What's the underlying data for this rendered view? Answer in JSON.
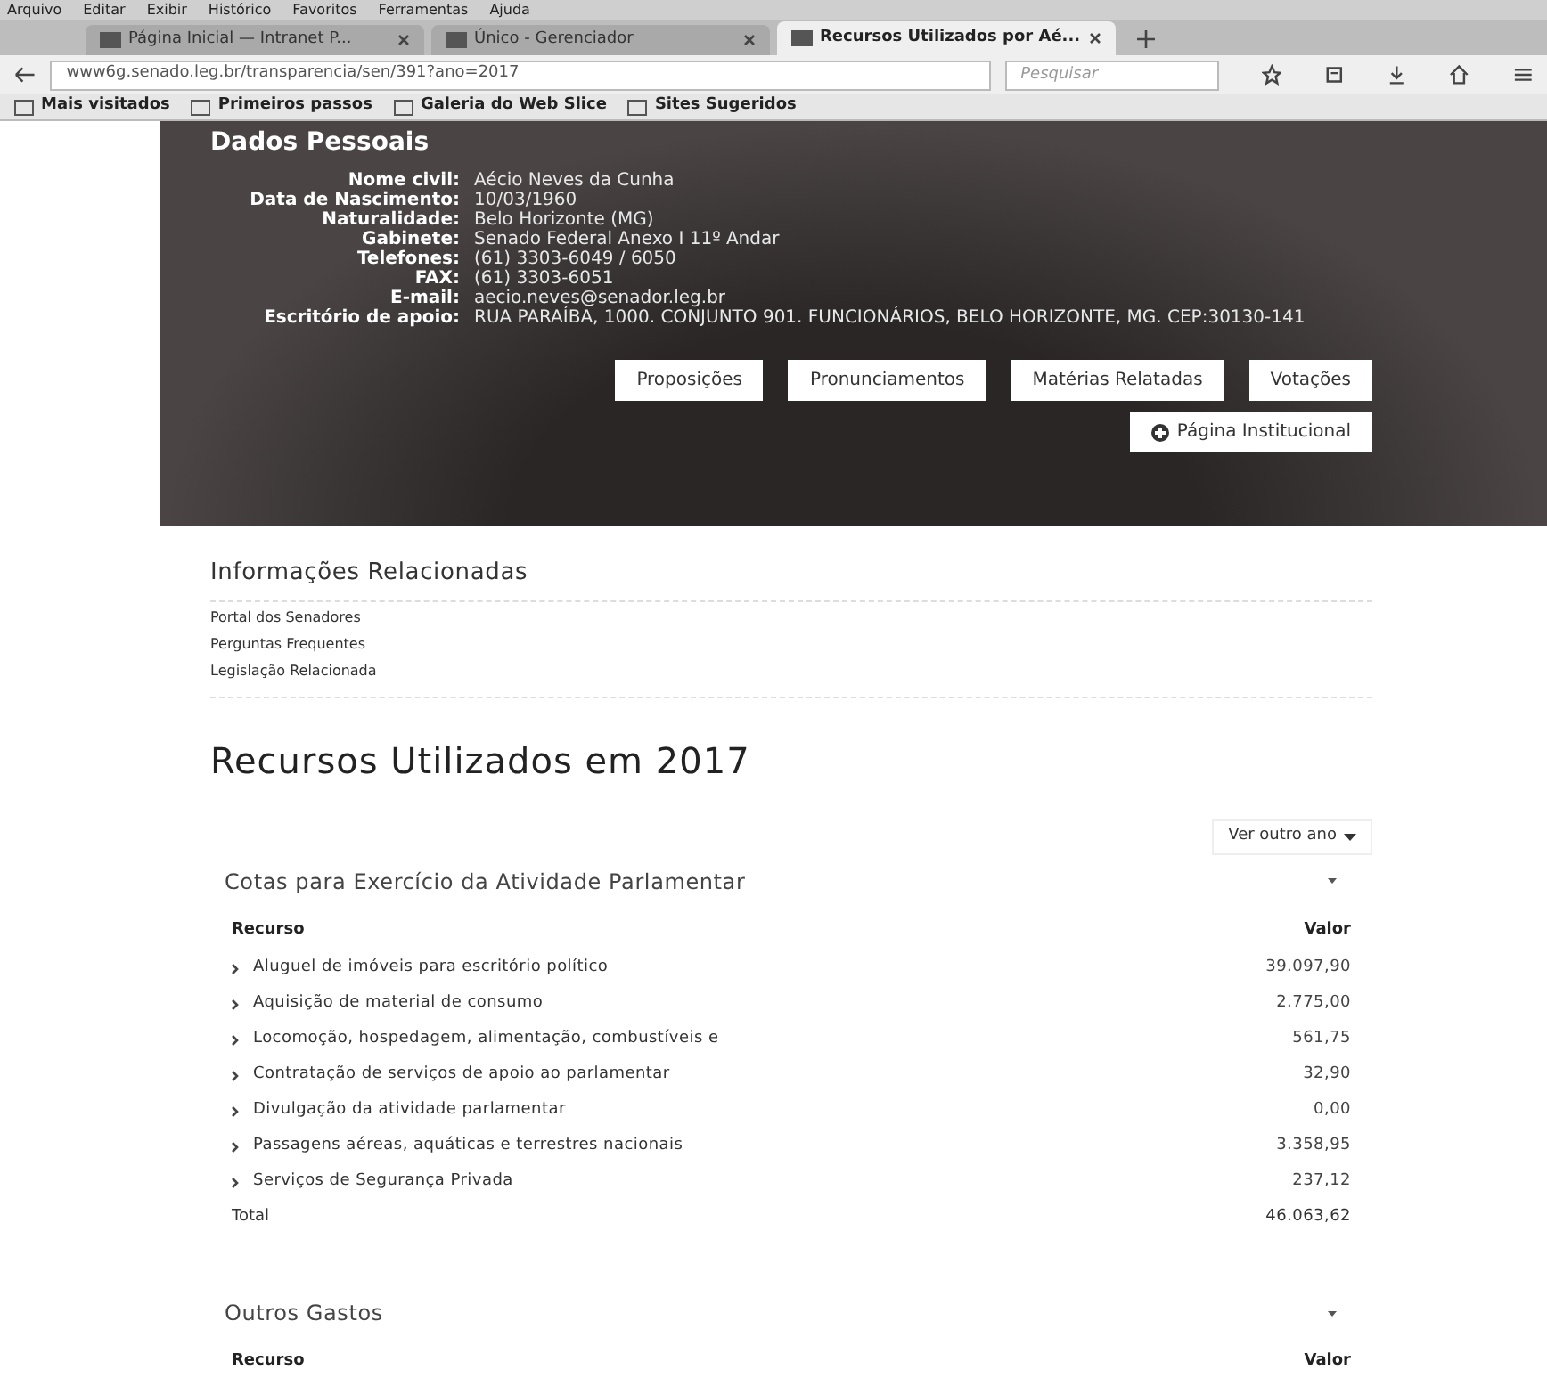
{
  "menu_bar": [
    "Arquivo",
    "Editar",
    "Exibir",
    "Histórico",
    "Favoritos",
    "Ferramentas",
    "Ajuda"
  ],
  "tabs": [
    {
      "label": "Página Inicial — Intranet P...",
      "selected": false
    },
    {
      "label": "Único - Gerenciador",
      "selected": false
    },
    {
      "label": "Recursos Utilizados por Aé...",
      "selected": true
    }
  ],
  "address_bar": {
    "url": "www6g.senado.leg.br/transparencia/sen/391?ano=2017"
  },
  "search": {
    "placeholder": "Pesquisar"
  },
  "bookmarks": [
    "Mais visitados",
    "Primeiros passos",
    "Galeria do Web Slice",
    "Sites Sugeridos"
  ],
  "personal_data": {
    "title": "Dados Pessoais",
    "fields": [
      {
        "label": "Nome civil:",
        "value": "Aécio Neves da Cunha"
      },
      {
        "label": "Data de Nascimento:",
        "value": "10/03/1960"
      },
      {
        "label": "Naturalidade:",
        "value": "Belo Horizonte (MG)"
      },
      {
        "label": "Gabinete:",
        "value": "Senado Federal Anexo I 11º Andar"
      },
      {
        "label": "Telefones:",
        "value": "(61) 3303-6049 / 6050"
      },
      {
        "label": "FAX:",
        "value": "(61) 3303-6051"
      },
      {
        "label": "E-mail:",
        "value": "aecio.neves@senador.leg.br"
      },
      {
        "label": "Escritório de apoio:",
        "value": "RUA PARAÍBA, 1000. CONJUNTO 901. FUNCIONÁRIOS, BELO HORIZONTE, MG. CEP:30130-141"
      }
    ],
    "buttons": [
      "Proposições",
      "Pronunciamentos",
      "Matérias Relatadas",
      "Votações"
    ],
    "institutional_button": "Página Institucional"
  },
  "related": {
    "title": "Informações Relacionadas",
    "links": [
      "Portal dos Senadores",
      "Perguntas Frequentes",
      "Legislação Relacionada"
    ]
  },
  "heading": "Recursos Utilizados em 2017",
  "year_button": "Ver outro ano",
  "sections": [
    {
      "title": "Cotas para Exercício da Atividade Parlamentar",
      "columns": [
        "Recurso",
        "Valor"
      ],
      "rows": [
        {
          "label": "Aluguel de imóveis para escritório político",
          "value": "39.097,90"
        },
        {
          "label": "Aquisição de material de consumo",
          "value": "2.775,00"
        },
        {
          "label": "Locomoção, hospedagem, alimentação, combustíveis e",
          "value": "561,75"
        },
        {
          "label": "Contratação de serviços de apoio ao parlamentar",
          "value": "32,90"
        },
        {
          "label": "Divulgação da atividade parlamentar",
          "value": "0,00"
        },
        {
          "label": "Passagens aéreas, aquáticas e terrestres nacionais",
          "value": "3.358,95"
        },
        {
          "label": "Serviços de Segurança Privada",
          "value": "237,12"
        }
      ],
      "total": {
        "label": "Total",
        "value": "46.063,62"
      }
    },
    {
      "title": "Outros Gastos",
      "columns": [
        "Recurso",
        "Valor"
      ]
    }
  ]
}
